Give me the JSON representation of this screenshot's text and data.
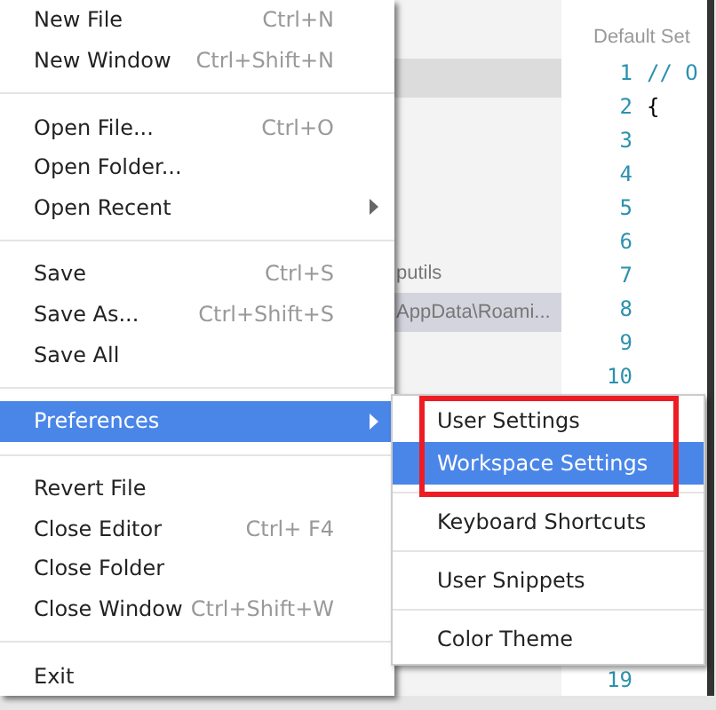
{
  "sidebar": {
    "rows": [
      {
        "highlighted": true
      },
      {
        "text": "putils",
        "highlighted": false
      },
      {
        "text": "AppData\\Roami...",
        "highlighted": true
      }
    ]
  },
  "editor": {
    "title": "Default Set",
    "lines": [
      {
        "number": "1",
        "code": "// O",
        "kind": "comment"
      },
      {
        "number": "2",
        "code": "{",
        "kind": "plain"
      },
      {
        "number": "3"
      },
      {
        "number": "4"
      },
      {
        "number": "5"
      },
      {
        "number": "6"
      },
      {
        "number": "7"
      },
      {
        "number": "8"
      },
      {
        "number": "9"
      },
      {
        "number": "10"
      },
      {
        "number": "19"
      }
    ]
  },
  "menu": {
    "groups": [
      [
        {
          "label": "New File",
          "shortcut": "Ctrl+N",
          "submenu": false,
          "selected": false
        },
        {
          "label": "New Window",
          "shortcut": "Ctrl+Shift+N",
          "submenu": false,
          "selected": false
        }
      ],
      [
        {
          "label": "Open File...",
          "shortcut": "Ctrl+O",
          "submenu": false,
          "selected": false
        },
        {
          "label": "Open Folder...",
          "submenu": false,
          "selected": false
        },
        {
          "label": "Open Recent",
          "submenu": true,
          "selected": false
        }
      ],
      [
        {
          "label": "Save",
          "shortcut": "Ctrl+S",
          "submenu": false,
          "selected": false
        },
        {
          "label": "Save As...",
          "shortcut": "Ctrl+Shift+S",
          "submenu": false,
          "selected": false
        },
        {
          "label": "Save All",
          "submenu": false,
          "selected": false
        }
      ],
      [
        {
          "label": "Preferences",
          "submenu": true,
          "selected": true
        }
      ],
      [
        {
          "label": "Revert File",
          "submenu": false,
          "selected": false
        },
        {
          "label": "Close Editor",
          "shortcut": "Ctrl+  F4",
          "submenu": false,
          "selected": false
        },
        {
          "label": "Close Folder",
          "submenu": false,
          "selected": false
        },
        {
          "label": "Close Window",
          "shortcut": "Ctrl+Shift+W",
          "submenu": false,
          "selected": false
        }
      ],
      [
        {
          "label": "Exit",
          "submenu": false,
          "selected": false
        }
      ]
    ]
  },
  "submenu": {
    "groups": [
      {
        "framed": true,
        "items": [
          {
            "label": "User Settings",
            "selected": false
          },
          {
            "label": "Workspace Settings",
            "selected": true
          }
        ]
      },
      {
        "framed": false,
        "items": [
          {
            "label": "Keyboard Shortcuts",
            "selected": false
          }
        ]
      },
      {
        "framed": false,
        "items": [
          {
            "label": "User Snippets",
            "selected": false
          }
        ]
      },
      {
        "framed": false,
        "items": [
          {
            "label": "Color Theme",
            "selected": false
          }
        ]
      }
    ]
  }
}
